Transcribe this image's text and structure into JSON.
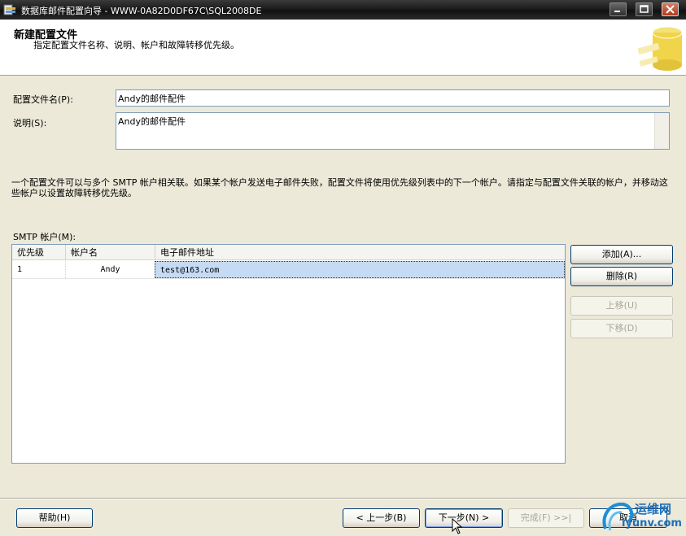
{
  "window": {
    "title": "数据库邮件配置向导 - WWW-0A82D0DF67C\\SQL2008DE"
  },
  "header": {
    "title": "新建配置文件",
    "subtitle": "指定配置文件名称、说明、帐户和故障转移优先级。"
  },
  "form": {
    "profile_name_label": "配置文件名(P):",
    "profile_name_value": "Andy的邮件配件",
    "description_label": "说明(S):",
    "description_value": "Andy的邮件配件",
    "info_text": "一个配置文件可以与多个 SMTP 帐户相关联。如果某个帐户发送电子邮件失败，配置文件将使用优先级列表中的下一个帐户。请指定与配置文件关联的帐户，并移动这些帐户以设置故障转移优先级。",
    "smtp_label": "SMTP 帐户(M):"
  },
  "grid": {
    "columns": [
      "优先级",
      "帐户名",
      "电子邮件地址"
    ],
    "rows": [
      {
        "priority": "1",
        "account": "Andy",
        "email": "test@163.com"
      }
    ]
  },
  "side_buttons": {
    "add": "添加(A)...",
    "remove": "删除(R)",
    "move_up": "上移(U)",
    "move_down": "下移(D)"
  },
  "footer": {
    "help": "帮助(H)",
    "back": "< 上一步(B)",
    "next": "下一步(N) >",
    "finish": "完成(F) >>|",
    "cancel": "取消"
  },
  "watermark": {
    "line1": "运维网",
    "line2": "iyunv.com"
  }
}
